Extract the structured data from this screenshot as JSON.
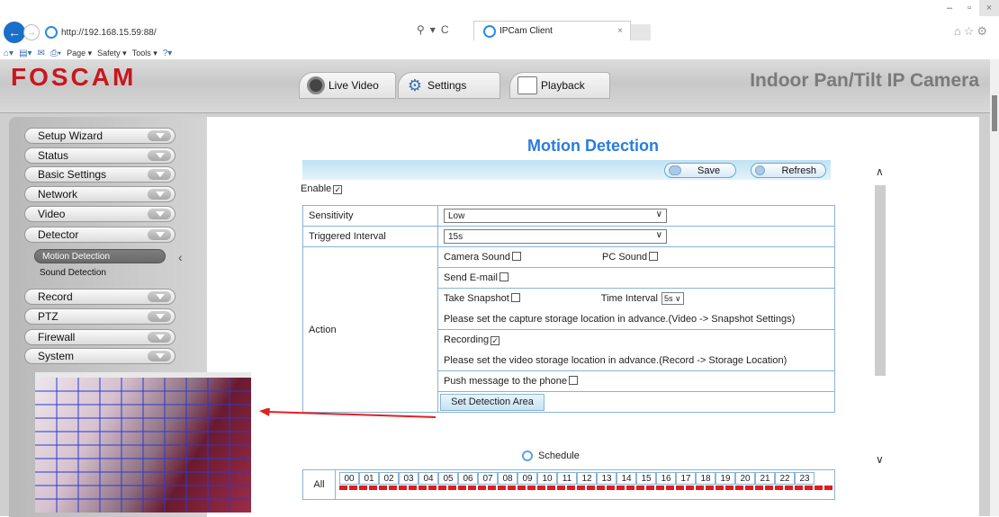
{
  "browser": {
    "url": "http://192.168.15.59:88/",
    "tab_title": "IPCam Client",
    "tab_close": "×",
    "addr_tools": [
      "⚲",
      "▾",
      "C"
    ],
    "window_controls": [
      "–",
      "▫",
      "×"
    ],
    "fav_icons": "⌂☆⚙",
    "command_bar": [
      "Page ▾",
      "Safety ▾",
      "Tools ▾"
    ]
  },
  "header": {
    "logo": "FOSCAM",
    "tabs": [
      {
        "label": "Live Video",
        "icon": "live-video-icon"
      },
      {
        "label": "Settings",
        "icon": "gear-icon"
      },
      {
        "label": "Playback",
        "icon": "calendar-icon"
      }
    ],
    "model": "Indoor Pan/Tilt IP Camera"
  },
  "sidebar": {
    "items": [
      "Setup Wizard",
      "Status",
      "Basic Settings",
      "Network",
      "Video",
      "Detector"
    ],
    "submenu": [
      "Motion Detection",
      "Sound Detection"
    ],
    "items_after": [
      "Record",
      "PTZ",
      "Firewall",
      "System"
    ]
  },
  "main": {
    "title": "Motion Detection",
    "save_label": "Save",
    "refresh_label": "Refresh",
    "enable_label": "Enable",
    "enable_checked": true,
    "sensitivity_label": "Sensitivity",
    "sensitivity_value": "Low",
    "interval_label": "Triggered Interval",
    "interval_value": "15s",
    "action_label": "Action",
    "camera_sound": "Camera Sound",
    "pc_sound": "PC Sound",
    "send_email": "Send E-mail",
    "take_snapshot": "Take Snapshot",
    "time_interval": "Time Interval",
    "time_interval_value": "5s",
    "snapshot_note": "Please set the capture storage location in advance.(Video -> Snapshot Settings)",
    "recording": "Recording",
    "recording_checked": true,
    "recording_note": "Please set the video storage location in advance.(Record -> Storage Location)",
    "push_message": "Push message to the phone",
    "set_area_button": "Set Detection Area",
    "schedule_label": "Schedule",
    "all_label": "All",
    "hours": [
      "00",
      "01",
      "02",
      "03",
      "04",
      "05",
      "06",
      "07",
      "08",
      "09",
      "10",
      "11",
      "12",
      "13",
      "14",
      "15",
      "16",
      "17",
      "18",
      "19",
      "20",
      "21",
      "22",
      "23"
    ]
  },
  "colors": {
    "logo": "#c8171e",
    "title": "#2a7ce0",
    "schedule_red": "#e31b1b",
    "arrow": "#e32020"
  }
}
